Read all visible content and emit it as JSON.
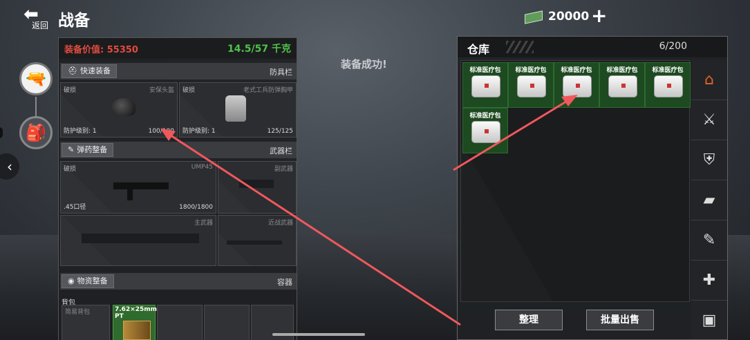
{
  "header": {
    "back_label": "返回",
    "title": "战备",
    "money": "20000"
  },
  "message": "装备成功!",
  "equip": {
    "value_label": "装备价值: 55350",
    "weight": "14.5/57 千克",
    "quick_equip": "快速装备",
    "armor_section": "防具栏",
    "helmet": {
      "status": "破损",
      "name": "安保头盔",
      "level": "防护级别: 1",
      "durability": "100/100"
    },
    "vest": {
      "status": "破损",
      "name": "老式工兵防弹胸甲",
      "level": "防护级别: 1",
      "durability": "125/125"
    },
    "ammo_equip": "弹药整备",
    "weapon_section": "武器栏",
    "primary_gun": {
      "status": "破损",
      "name": "UMP45",
      "caliber": ".45口径",
      "durability": "1800/1800"
    },
    "secondary_label": "副武器",
    "main_label": "主武器",
    "melee_label": "近战武器",
    "supply_equip": "物资整备",
    "container_section": "容器",
    "backpack_label": "背包",
    "backpack_item": "简易背包",
    "ammo_item": "7.62×25mm PT"
  },
  "warehouse": {
    "title": "仓库",
    "count": "6/200",
    "item_name": "标准医疗包",
    "sort_button": "整理",
    "bulk_sell_button": "批量出售"
  }
}
